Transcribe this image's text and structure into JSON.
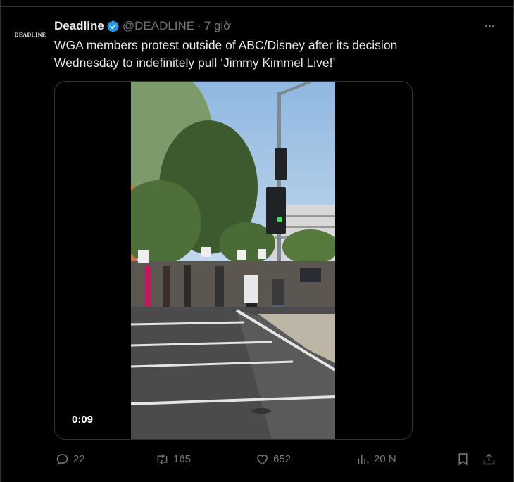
{
  "tweet": {
    "avatar_text": "DEADLINE",
    "author_name": "Deadline",
    "handle": "@DEADLINE",
    "separator": "·",
    "time": "7 giờ",
    "text_line1": "WGA members protest outside of ABC/Disney after its decision",
    "text_line2": "Wednesday to indefinitely pull ‘Jimmy Kimmel Live!’"
  },
  "media": {
    "duration": "0:09"
  },
  "actions": {
    "replies": "22",
    "reposts": "165",
    "likes": "652",
    "views": "20 N"
  },
  "icons": {
    "verified": "verified-badge-icon",
    "more": "more-icon",
    "reply": "reply-icon",
    "repost": "repost-icon",
    "like": "like-icon",
    "views": "views-icon",
    "bookmark": "bookmark-icon",
    "share": "share-icon"
  },
  "colors": {
    "background": "#000000",
    "text": "#e7e9ea",
    "muted": "#71767b",
    "verified": "#1d9bf0",
    "border": "#2f3336"
  }
}
